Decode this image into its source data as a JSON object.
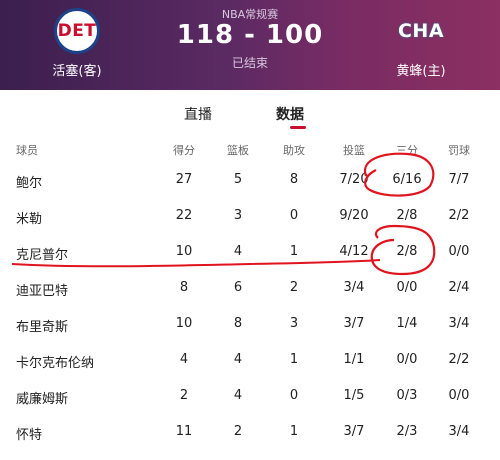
{
  "header": {
    "league": "NBA常规赛",
    "score": "118 - 100",
    "status": "已结束",
    "away": {
      "abbr": "DET",
      "name": "活塞(客)"
    },
    "home": {
      "abbr": "CHA",
      "name": "黄蜂(主)"
    }
  },
  "tabs": {
    "live": "直播",
    "stats": "数据"
  },
  "table": {
    "headers": [
      "球员",
      "得分",
      "篮板",
      "助攻",
      "投篮",
      "三分",
      "罚球"
    ],
    "rows": [
      [
        "鲍尔",
        "27",
        "5",
        "8",
        "7/20",
        "6/16",
        "7/7"
      ],
      [
        "米勒",
        "22",
        "3",
        "0",
        "9/20",
        "2/8",
        "2/2"
      ],
      [
        "克尼普尔",
        "10",
        "4",
        "1",
        "4/12",
        "2/8",
        "0/0"
      ],
      [
        "迪亚巴特",
        "8",
        "6",
        "2",
        "3/4",
        "0/0",
        "2/4"
      ],
      [
        "布里奇斯",
        "10",
        "8",
        "3",
        "3/7",
        "1/4",
        "3/4"
      ],
      [
        "卡尔克布伦纳",
        "4",
        "4",
        "1",
        "1/1",
        "0/0",
        "2/2"
      ],
      [
        "威廉姆斯",
        "2",
        "4",
        "0",
        "1/5",
        "0/3",
        "0/0"
      ],
      [
        "怀特",
        "11",
        "2",
        "1",
        "3/7",
        "2/3",
        "3/4"
      ]
    ]
  },
  "colors": {
    "header_start": "#3b1f4e",
    "header_end": "#8c2f62",
    "accent": "#c8102e",
    "annotation": "#e0141e"
  }
}
